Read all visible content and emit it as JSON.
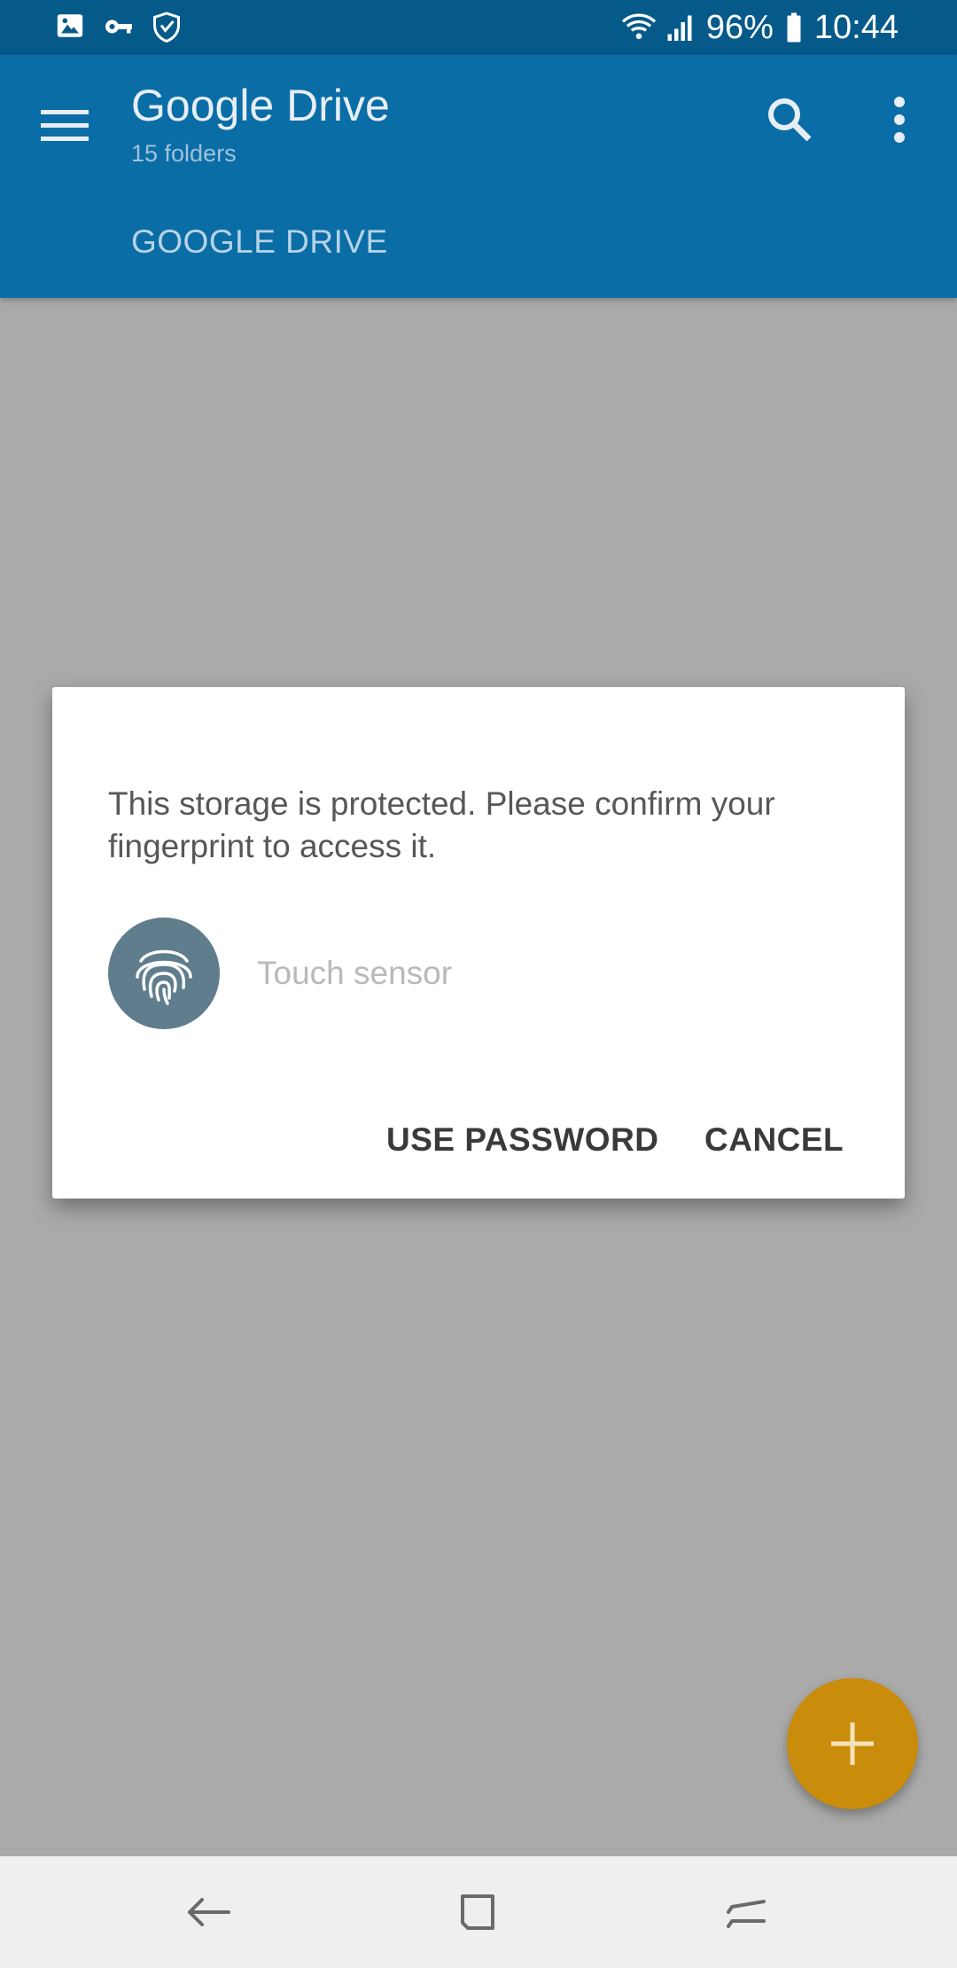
{
  "status_bar": {
    "battery": "96%",
    "time": "10:44",
    "left_icons": [
      "image-icon",
      "key-icon",
      "shield-icon"
    ],
    "right_icons": [
      "wifi-icon",
      "signal-icon",
      "battery-icon"
    ]
  },
  "app_bar": {
    "title": "Google Drive",
    "subtitle": "15 folders",
    "tab": "GOOGLE DRIVE"
  },
  "dialog": {
    "message": "This storage is protected. Please confirm your fingerprint to access it.",
    "sensor_label": "Touch sensor",
    "use_password_label": "USE PASSWORD",
    "cancel_label": "CANCEL"
  },
  "colors": {
    "status_bar": "#055a8a",
    "app_bar": "#0a6da6",
    "scrim": "#aaaaaa",
    "fab": "#c98c0b",
    "fingerprint_circle": "#5f7d8c"
  }
}
